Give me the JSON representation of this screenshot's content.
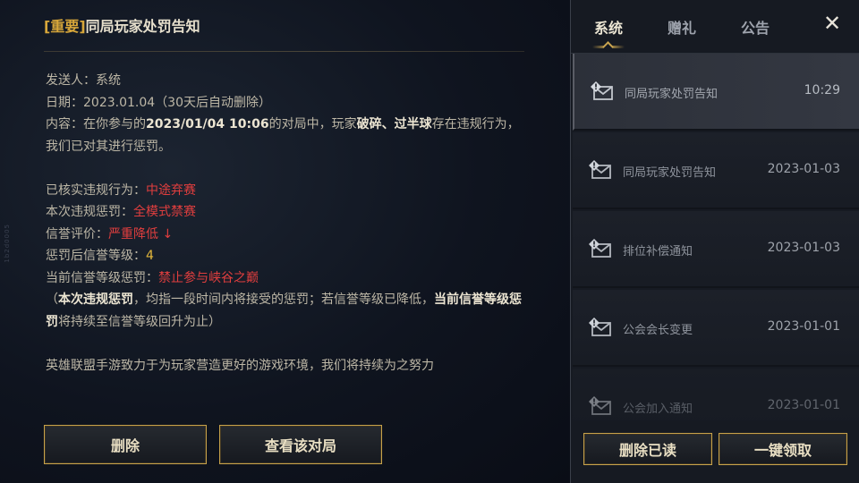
{
  "mail": {
    "tag": "[重要]",
    "title": "同局玩家处罚告知",
    "sender_label": "发送人：",
    "sender": "系统",
    "date_label": "日期：",
    "date": "2023.01.04",
    "date_note": "（30天后自动删除）",
    "content_label": "内容：",
    "content_pre": "在你参与的",
    "content_time": "2023/01/04 10:06",
    "content_mid": "的对局中，玩家",
    "content_tags": "破碎、过半球",
    "content_post": "存在违规行为，我们已对其进行惩罚。",
    "violation_label": "已核实违规行为：",
    "violation": "中途弃赛",
    "punishment_label": "本次违规惩罚：",
    "punishment": "全模式禁赛",
    "credit_label": "信誉评价：",
    "credit": "严重降低 ↓",
    "credit_level_label": "惩罚后信誉等级：",
    "credit_level": "4",
    "credit_limit_label": "当前信誉等级惩罚：",
    "credit_limit": "禁止参与峡谷之巅",
    "note_open": "（",
    "note_bold1": "本次违规惩罚",
    "note_mid": "，均指一段时间内将接受的惩罚；若信誉等级已降低，",
    "note_bold2": "当前信誉等级惩罚",
    "note_end": "将持续至信誉等级回升为止）",
    "footer": "英雄联盟手游致力于为玩家营造更好的游戏环境，我们将持续为之努力"
  },
  "buttons": {
    "delete": "删除",
    "view_match": "查看该对局",
    "delete_read": "删除已读",
    "claim_all": "一键领取"
  },
  "tabs": {
    "system": "系统",
    "gift": "赠礼",
    "notice": "公告",
    "close": "✕"
  },
  "list": [
    {
      "title": "同局玩家处罚告知",
      "time": "10:29"
    },
    {
      "title": "同局玩家处罚告知",
      "time": "2023-01-03"
    },
    {
      "title": "排位补偿通知",
      "time": "2023-01-03"
    },
    {
      "title": "公会会长变更",
      "time": "2023-01-01"
    },
    {
      "title": "公会加入通知",
      "time": "2023-01-01"
    }
  ],
  "watermark": "1b2d0005",
  "colors": {
    "accent_gold": "#c7a24b",
    "warning_red": "#e03e3e",
    "level_gold": "#e5b83b"
  }
}
